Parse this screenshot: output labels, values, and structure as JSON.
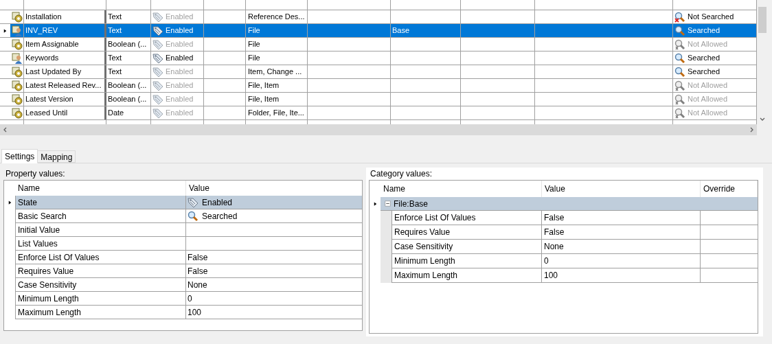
{
  "grid": {
    "rows": [
      {
        "kind": "gear",
        "name": "Installation",
        "type": "Text",
        "state": "Enabled",
        "state_enabled": false,
        "categories": "Reference Des...",
        "column_7": "",
        "search": {
          "kind": "not_searched",
          "text": "Not Searched"
        },
        "selected": false
      },
      {
        "kind": "user",
        "name": "INV_REV",
        "type": "Text",
        "state": "Enabled",
        "state_enabled": true,
        "categories": "File",
        "column_7": "Base",
        "search": {
          "kind": "searched",
          "text": "Searched"
        },
        "selected": true
      },
      {
        "kind": "gear",
        "name": "Item Assignable",
        "type": "Boolean (...",
        "state": "Enabled",
        "state_enabled": false,
        "categories": "File",
        "column_7": "",
        "search": {
          "kind": "not_allowed",
          "text": "Not Allowed"
        },
        "selected": false
      },
      {
        "kind": "user",
        "name": "Keywords",
        "type": "Text",
        "state": "Enabled",
        "state_enabled": true,
        "categories": "File",
        "column_7": "",
        "search": {
          "kind": "searched",
          "text": "Searched"
        },
        "selected": false
      },
      {
        "kind": "gear",
        "name": "Last Updated By",
        "type": "Text",
        "state": "Enabled",
        "state_enabled": false,
        "categories": "Item, Change ...",
        "column_7": "",
        "search": {
          "kind": "searched",
          "text": "Searched"
        },
        "selected": false
      },
      {
        "kind": "gear",
        "name": "Latest Released Rev...",
        "type": "Boolean (...",
        "state": "Enabled",
        "state_enabled": false,
        "categories": "File, Item",
        "column_7": "",
        "search": {
          "kind": "not_allowed",
          "text": "Not Allowed"
        },
        "selected": false
      },
      {
        "kind": "gear",
        "name": "Latest Version",
        "type": "Boolean (...",
        "state": "Enabled",
        "state_enabled": false,
        "categories": "File, Item",
        "column_7": "",
        "search": {
          "kind": "not_allowed",
          "text": "Not Allowed"
        },
        "selected": false
      },
      {
        "kind": "gear",
        "name": "Leased Until",
        "type": "Date",
        "state": "Enabled",
        "state_enabled": false,
        "categories": "Folder, File, Ite...",
        "column_7": "",
        "search": {
          "kind": "not_allowed",
          "text": "Not Allowed"
        },
        "selected": false
      }
    ]
  },
  "tabs": [
    {
      "label": "Settings",
      "selected": true
    },
    {
      "label": "Mapping",
      "selected": false
    }
  ],
  "property_values": {
    "label": "Property values:",
    "columns": [
      "Name",
      "Value"
    ],
    "rows": [
      {
        "name": "State",
        "value": "Enabled",
        "kind": "tag",
        "selected": true
      },
      {
        "name": "Basic Search",
        "value": "Searched",
        "kind": "search",
        "selected": false
      },
      {
        "name": "Initial Value",
        "value": "",
        "kind": "text",
        "selected": false
      },
      {
        "name": "List Values",
        "value": "",
        "kind": "text",
        "selected": false
      },
      {
        "name": "Enforce List Of Values",
        "value": "False",
        "kind": "text",
        "selected": false
      },
      {
        "name": "Requires Value",
        "value": "False",
        "kind": "text",
        "selected": false
      },
      {
        "name": "Case Sensitivity",
        "value": "None",
        "kind": "text",
        "selected": false
      },
      {
        "name": "Minimum Length",
        "value": "0",
        "kind": "text",
        "selected": false
      },
      {
        "name": "Maximum Length",
        "value": "100",
        "kind": "text",
        "selected": false
      }
    ]
  },
  "category_values": {
    "label": "Category values:",
    "columns": [
      "Name",
      "Value",
      "Override"
    ],
    "group": {
      "title": "File:Base",
      "expanded": true,
      "selected": true,
      "rows": [
        {
          "name": "Enforce List Of Values",
          "value": "False"
        },
        {
          "name": "Requires Value",
          "value": "False"
        },
        {
          "name": "Case Sensitivity",
          "value": "None"
        },
        {
          "name": "Minimum Length",
          "value": "0"
        },
        {
          "name": "Maximum Length",
          "value": "100"
        }
      ]
    }
  }
}
